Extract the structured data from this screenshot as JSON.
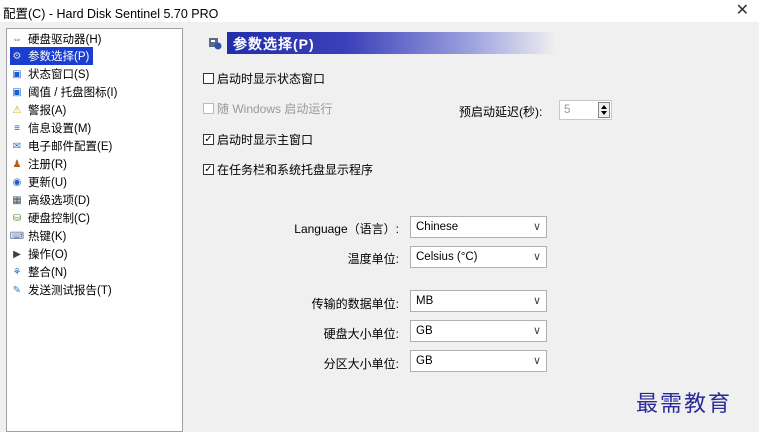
{
  "window": {
    "title": "配置(C)  -  Hard Disk Sentinel 5.70 PRO",
    "close": "✕"
  },
  "sidebar": {
    "items": [
      {
        "label": "硬盘驱动器(H)",
        "icon": "disk-drive-icon",
        "glyph": "⇔"
      },
      {
        "label": "参数选择(P)",
        "icon": "preferences-icon",
        "glyph": "⚙",
        "selected": true
      },
      {
        "label": "状态窗口(S)",
        "icon": "window-icon",
        "glyph": "▣"
      },
      {
        "label": "阈值 / 托盘图标(I)",
        "icon": "tray-icon",
        "glyph": "▣"
      },
      {
        "label": "警报(A)",
        "icon": "warning-icon",
        "glyph": "⚠"
      },
      {
        "label": "信息设置(M)",
        "icon": "info-doc-icon",
        "glyph": "≡"
      },
      {
        "label": "电子邮件配置(E)",
        "icon": "email-icon",
        "glyph": "✉"
      },
      {
        "label": "注册(R)",
        "icon": "register-icon",
        "glyph": "♟"
      },
      {
        "label": "更新(U)",
        "icon": "update-globe-icon",
        "glyph": "◉"
      },
      {
        "label": "高级选项(D)",
        "icon": "advanced-icon",
        "glyph": "▦"
      },
      {
        "label": "硬盘控制(C)",
        "icon": "disk-control-icon",
        "glyph": "⛁"
      },
      {
        "label": "热键(K)",
        "icon": "hotkey-icon",
        "glyph": "⌨"
      },
      {
        "label": "操作(O)",
        "icon": "actions-icon",
        "glyph": "▶"
      },
      {
        "label": "整合(N)",
        "icon": "integration-icon",
        "glyph": "⚘"
      },
      {
        "label": "发送测试报告(T)",
        "icon": "send-report-icon",
        "glyph": "✎"
      }
    ]
  },
  "main": {
    "header": "参数选择(P)",
    "options": {
      "show_status_window": {
        "label": "启动时显示状态窗口",
        "checked": false,
        "check": ""
      },
      "run_with_windows": {
        "label": "随 Windows 启动运行",
        "checked": false,
        "check": "",
        "disabled": true
      },
      "show_main_window": {
        "label": "启动时显示主窗口",
        "checked": true,
        "check": "✓"
      },
      "show_in_taskbar": {
        "label": "在任务栏和系统托盘显示程序",
        "checked": true,
        "check": "✓"
      }
    },
    "startup_delay": {
      "label": "预启动延迟(秒):",
      "value": "5"
    },
    "fields": {
      "language": {
        "label": "Language（语言）:",
        "value": "Chinese"
      },
      "temperature": {
        "label": "温度单位:",
        "value": "Celsius (°C)"
      },
      "data_unit": {
        "label": "传输的数据单位:",
        "value": "MB"
      },
      "disk_size_unit": {
        "label": "硬盘大小单位:",
        "value": "GB"
      },
      "partition_size_unit": {
        "label": "分区大小单位:",
        "value": "GB"
      }
    },
    "dropdown_arrow": "∨"
  },
  "watermark": "最需教育",
  "colors": {
    "selection": "#1a3fd0",
    "header_start": "#1e2aa8",
    "watermark": "#2a2a9a"
  }
}
